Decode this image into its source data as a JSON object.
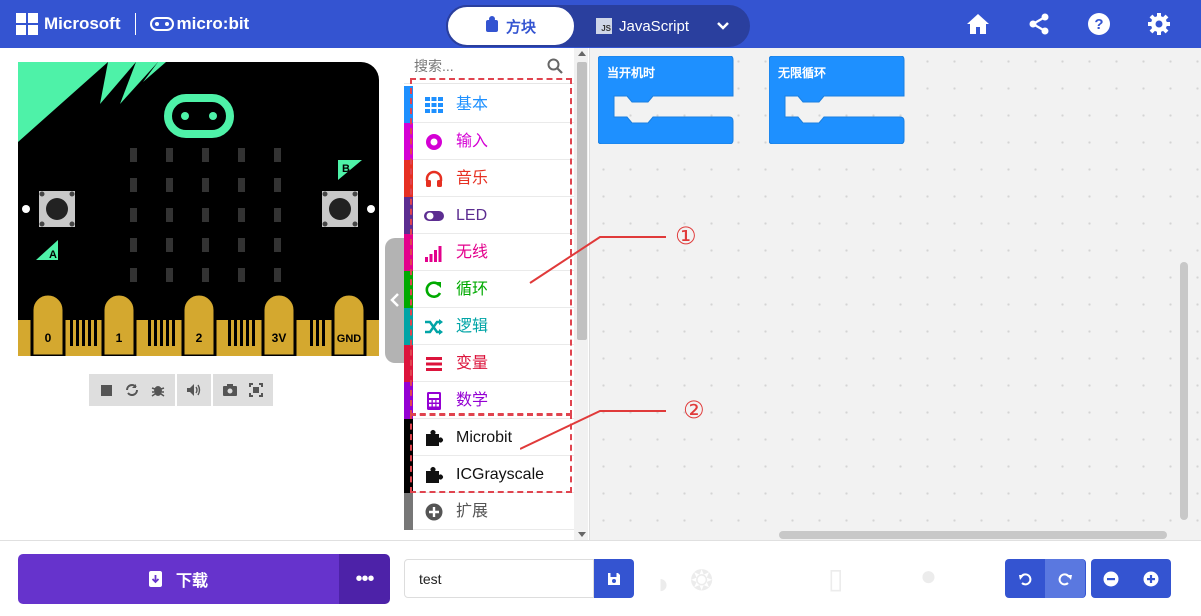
{
  "header": {
    "brand": "Microsoft",
    "product": "micro:bit",
    "tabs": {
      "blocks": "方块",
      "javascript": "JavaScript"
    },
    "colors": {
      "bar": "#3454D1"
    }
  },
  "toolbox": {
    "search_placeholder": "搜索...",
    "categories": [
      {
        "label": "基本",
        "color": "#1E90FF",
        "icon": "grid-icon"
      },
      {
        "label": "输入",
        "color": "#D400D4",
        "icon": "target-icon"
      },
      {
        "label": "音乐",
        "color": "#E63022",
        "icon": "headphones-icon"
      },
      {
        "label": "LED",
        "color": "#5C2D91",
        "icon": "toggle-icon"
      },
      {
        "label": "无线",
        "color": "#E3008C",
        "icon": "signal-bars-icon"
      },
      {
        "label": "循环",
        "color": "#00AA00",
        "icon": "loop-arrow-icon"
      },
      {
        "label": "逻辑",
        "color": "#00A4A6",
        "icon": "shuffle-icon"
      },
      {
        "label": "变量",
        "color": "#DC143C",
        "icon": "list-icon"
      },
      {
        "label": "数学",
        "color": "#9400D3",
        "icon": "calculator-icon"
      },
      {
        "label": "Microbit",
        "color": "#000000",
        "icon": "puzzle-icon"
      },
      {
        "label": "ICGrayscale",
        "color": "#000000",
        "icon": "puzzle-icon"
      },
      {
        "label": "扩展",
        "color": "#555555",
        "icon": "plus-circle-icon"
      }
    ]
  },
  "workspace": {
    "blocks": [
      {
        "label": "当开机时",
        "color": "#1E90FF"
      },
      {
        "label": "无限循环",
        "color": "#1E90FF"
      }
    ],
    "annotations": [
      "①",
      "②"
    ],
    "annotation_color": "#e03a3a"
  },
  "simulator": {
    "pins": [
      "0",
      "1",
      "2",
      "3V",
      "GND"
    ],
    "buttons": [
      "A",
      "B"
    ]
  },
  "footer": {
    "download_label": "下载",
    "more_label": "•••",
    "project_name": "test"
  }
}
